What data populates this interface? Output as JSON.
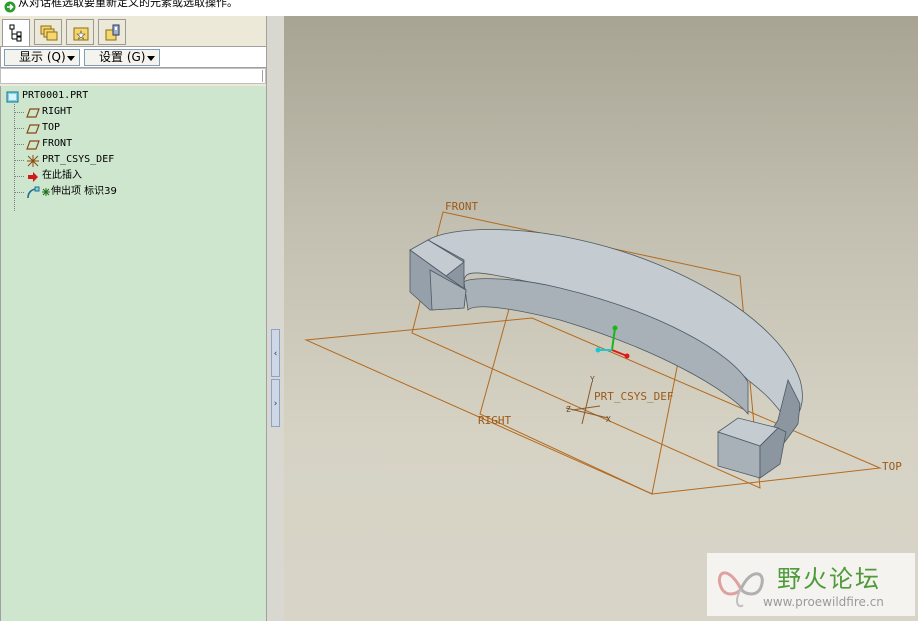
{
  "message_bar": {
    "text": "从对话框选取要重新定义的元素或选取操作。"
  },
  "nav_tabs": [
    "model-tree-icon",
    "folder-browser-icon",
    "favorites-icon",
    "connections-icon"
  ],
  "toolbar": {
    "show_label": "显示 (Q)",
    "settings_label": "设置 (G)"
  },
  "model_tree": {
    "root": "PRT0001.PRT",
    "items": [
      {
        "label": "RIGHT",
        "icon": "datum-plane-icon"
      },
      {
        "label": "TOP",
        "icon": "datum-plane-icon"
      },
      {
        "label": "FRONT",
        "icon": "datum-plane-icon"
      },
      {
        "label": "PRT_CSYS_DEF",
        "icon": "csys-icon"
      },
      {
        "label": "在此插入",
        "icon": "insert-arrow-icon"
      },
      {
        "label": "伸出项 标识39",
        "icon": "protrusion-icon"
      }
    ]
  },
  "viewport": {
    "datum_labels": {
      "front": "FRONT",
      "right": "RIGHT",
      "top": "TOP",
      "csys": "PRT_CSYS_DEF"
    },
    "axis_labels": {
      "x": "X",
      "y": "Y",
      "z": "Z"
    },
    "colors": {
      "datum": "#b36a1e",
      "part_light": "#c4ccd2",
      "part_mid": "#a8b1b8",
      "part_dark": "#8c96a0",
      "edge": "#4d5964"
    }
  },
  "watermark": {
    "title": "野火论坛",
    "url": "www.proewildfire.cn"
  }
}
